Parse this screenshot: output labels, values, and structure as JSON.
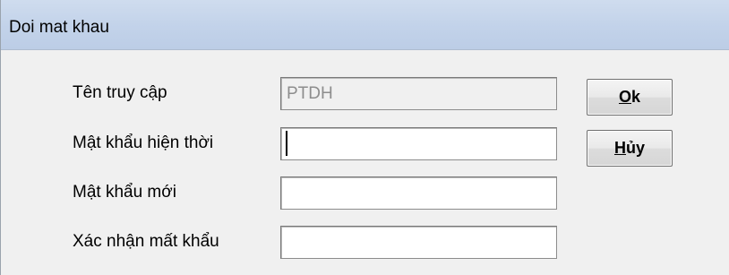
{
  "window": {
    "title": "Doi mat khau"
  },
  "form": {
    "username_label": "Tên truy cập",
    "username_value": "PTDH",
    "current_password_label": "Mật khẩu hiện thời",
    "current_password_value": "",
    "new_password_label": "Mật khẩu mới",
    "new_password_value": "",
    "confirm_password_label": "Xác nhận mất khẩu",
    "confirm_password_value": ""
  },
  "buttons": {
    "ok_mnemonic": "O",
    "ok_rest": "k",
    "cancel_mnemonic": "H",
    "cancel_rest": "ủy"
  }
}
